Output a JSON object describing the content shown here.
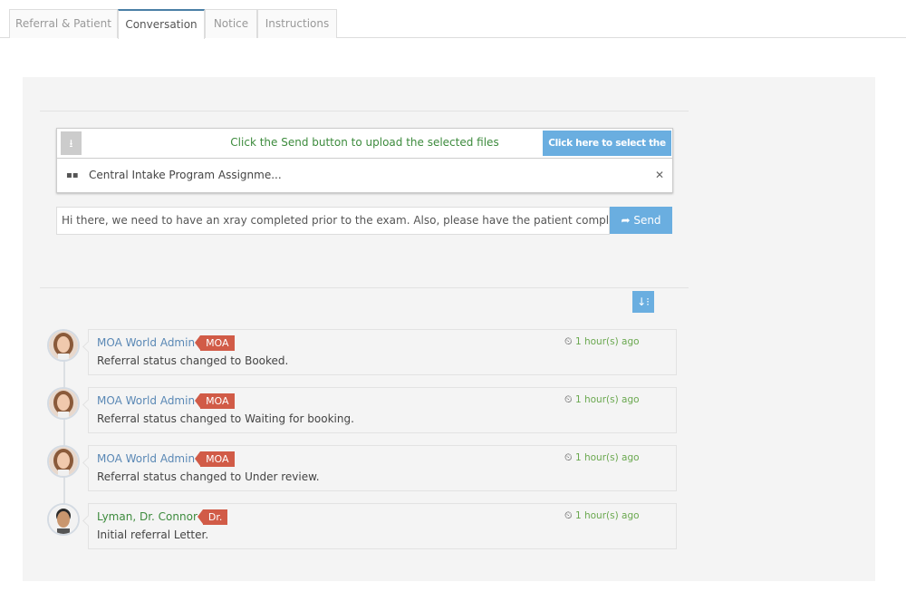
{
  "tabs": [
    {
      "label": "Referral & Patient"
    },
    {
      "label": "Conversation",
      "active": true
    },
    {
      "label": "Notice"
    },
    {
      "label": "Instructions"
    }
  ],
  "upload": {
    "hint": "Click the Send button to upload the selected files",
    "select_button": "Click here to select the files",
    "file_name": "Central Intake Program Assignme...",
    "icon": "upload-icon",
    "remove_icon": "close-icon"
  },
  "composer": {
    "message": "Hi there, we need to have an xray completed prior to the exam. Also, please have the patient complete",
    "send_label": "Send"
  },
  "sort_button": {
    "icon": "sort-icon"
  },
  "colors": {
    "accent": "#6aaee0",
    "badge": "#d15b47",
    "time": "#6aa84f",
    "name": "#5a88b5"
  },
  "feed": [
    {
      "author": "MOA World Admin",
      "role": "MOA",
      "text": "Referral status changed to Booked.",
      "time": "1 hour(s) ago"
    },
    {
      "author": "MOA World Admin",
      "role": "MOA",
      "text": "Referral status changed to Waiting for booking.",
      "time": "1 hour(s) ago"
    },
    {
      "author": "MOA World Admin",
      "role": "MOA",
      "text": "Referral status changed to Under review.",
      "time": "1 hour(s) ago"
    },
    {
      "author": "Lyman, Dr. Connor",
      "role": "Dr.",
      "text": "Initial referral Letter.",
      "time": "1 hour(s) ago"
    }
  ]
}
